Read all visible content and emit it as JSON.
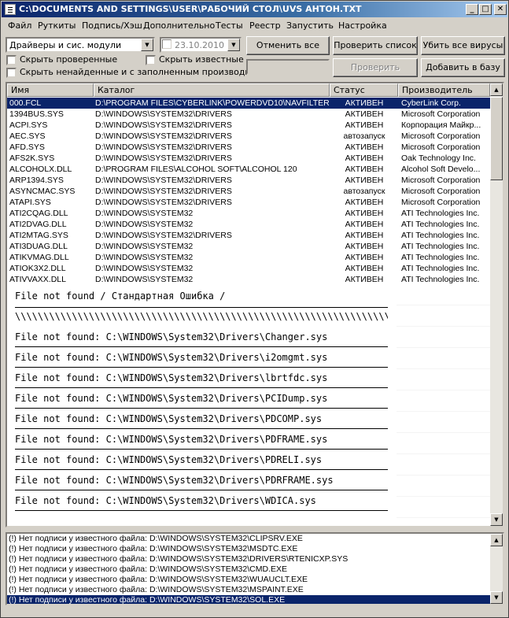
{
  "window": {
    "title": "C:\\DOCUMENTS AND SETTINGS\\USER\\РАБОЧИЙ СТОЛ\\UVS АНТОН.TXT",
    "min": "_",
    "max": "□",
    "close": "✕"
  },
  "menu": [
    "Файл",
    "Руткиты",
    "Подпись/Хэш",
    "Дополнительно",
    "Тесты",
    "Реестр",
    "Запустить",
    "Настройка"
  ],
  "toolbar": {
    "filter_combo": "Драйверы и сис. модули",
    "date_combo": "23.10.2010",
    "cancel_all": "Отменить все",
    "check_list": "Проверить список",
    "kill_all": "Убить все вирусы",
    "check_catalog": "Проверить каталог",
    "add_to_db": "Добавить в базу",
    "hide_checked": "Скрыть проверенные",
    "hide_known": "Скрыть известные",
    "hide_unfound": "Скрыть ненайденные и с заполненным производителем"
  },
  "grid": {
    "columns": [
      "Имя",
      "Каталог",
      "Статус",
      "Производитель"
    ],
    "rows": [
      [
        "000.FCL",
        "D:\\PROGRAM FILES\\CYBERLINK\\POWERDVD10\\NAVFILTER",
        "АКТИВЕН",
        "CyberLink Corp."
      ],
      [
        "1394BUS.SYS",
        "D:\\WINDOWS\\SYSTEM32\\DRIVERS",
        "АКТИВЕН",
        "Microsoft Corporation"
      ],
      [
        "ACPI.SYS",
        "D:\\WINDOWS\\SYSTEM32\\DRIVERS",
        "АКТИВЕН",
        "Корпорация Майкр..."
      ],
      [
        "AEC.SYS",
        "D:\\WINDOWS\\SYSTEM32\\DRIVERS",
        "автозапуск",
        "Microsoft Corporation"
      ],
      [
        "AFD.SYS",
        "D:\\WINDOWS\\SYSTEM32\\DRIVERS",
        "АКТИВЕН",
        "Microsoft Corporation"
      ],
      [
        "AFS2K.SYS",
        "D:\\WINDOWS\\SYSTEM32\\DRIVERS",
        "АКТИВЕН",
        "Oak Technology Inc."
      ],
      [
        "ALCOHOLX.DLL",
        "D:\\PROGRAM FILES\\ALCOHOL SOFT\\ALCOHOL 120",
        "АКТИВЕН",
        "Alcohol Soft Develo..."
      ],
      [
        "ARP1394.SYS",
        "D:\\WINDOWS\\SYSTEM32\\DRIVERS",
        "АКТИВЕН",
        "Microsoft Corporation"
      ],
      [
        "ASYNCMAC.SYS",
        "D:\\WINDOWS\\SYSTEM32\\DRIVERS",
        "автозапуск",
        "Microsoft Corporation"
      ],
      [
        "ATAPI.SYS",
        "D:\\WINDOWS\\SYSTEM32\\DRIVERS",
        "АКТИВЕН",
        "Microsoft Corporation"
      ],
      [
        "ATI2CQAG.DLL",
        "D:\\WINDOWS\\SYSTEM32",
        "АКТИВЕН",
        "ATI Technologies Inc."
      ],
      [
        "ATI2DVAG.DLL",
        "D:\\WINDOWS\\SYSTEM32",
        "АКТИВЕН",
        "ATI Technologies Inc."
      ],
      [
        "ATI2MTAG.SYS",
        "D:\\WINDOWS\\SYSTEM32\\DRIVERS",
        "АКТИВЕН",
        "ATI Technologies Inc."
      ],
      [
        "ATI3DUAG.DLL",
        "D:\\WINDOWS\\SYSTEM32",
        "АКТИВЕН",
        "ATI Technologies Inc."
      ],
      [
        "ATIKVMAG.DLL",
        "D:\\WINDOWS\\SYSTEM32",
        "АКТИВЕН",
        "ATI Technologies Inc."
      ],
      [
        "ATIOK3X2.DLL",
        "D:\\WINDOWS\\SYSTEM32",
        "АКТИВЕН",
        "ATI Technologies Inc."
      ],
      [
        "ATIVVAXX.DLL",
        "D:\\WINDOWS\\SYSTEM32",
        "АКТИВЕН",
        "ATI Technologies Inc."
      ]
    ]
  },
  "error_overlay": {
    "heading": "File not found / Стандартная Ошибка /",
    "separator": "\\\\\\\\\\\\\\\\\\\\\\\\\\\\\\\\\\\\\\\\\\\\\\\\\\\\\\\\\\\\\\\\\\\\\\\\\\\\\\\\\\\\\\\\\\\\\\\\\\\\\\\\\\\\\\\\\\\\\\\\\\\\\\\\\\\\\\\\\\\\\\\\\\\\\\\\",
    "lines": [
      "File not found: C:\\WINDOWS\\System32\\Drivers\\Changer.sys",
      "File not found: C:\\WINDOWS\\System32\\Drivers\\i2omgmt.sys",
      "File not found: C:\\WINDOWS\\System32\\Drivers\\lbrtfdc.sys",
      "File not found: C:\\WINDOWS\\System32\\Drivers\\PCIDump.sys",
      "File not found: C:\\WINDOWS\\System32\\Drivers\\PDCOMP.sys",
      "File not found: C:\\WINDOWS\\System32\\Drivers\\PDFRAME.sys",
      "File not found: C:\\WINDOWS\\System32\\Drivers\\PDRELI.sys",
      "File not found: C:\\WINDOWS\\System32\\Drivers\\PDRFRAME.sys",
      "File not found: C:\\WINDOWS\\System32\\Drivers\\WDICA.sys"
    ]
  },
  "log": [
    "(!) Нет подписи у известного файла: D:\\WINDOWS\\SYSTEM32\\CLIPSRV.EXE",
    "(!) Нет подписи у известного файла: D:\\WINDOWS\\SYSTEM32\\MSDTC.EXE",
    "(!) Нет подписи у известного файла: D:\\WINDOWS\\SYSTEM32\\DRIVERS\\RTENICXP.SYS",
    "(!) Нет подписи у известного файла: D:\\WINDOWS\\SYSTEM32\\CMD.EXE",
    "(!) Нет подписи у известного файла: D:\\WINDOWS\\SYSTEM32\\WUAUCLT.EXE",
    "(!) Нет подписи у известного файла: D:\\WINDOWS\\SYSTEM32\\MSPAINT.EXE",
    "(!) Нет подписи у известного файла: D:\\WINDOWS\\SYSTEM32\\SOL.EXE"
  ],
  "colors": {
    "selection": "#0a246a",
    "face": "#d4d0c8"
  }
}
